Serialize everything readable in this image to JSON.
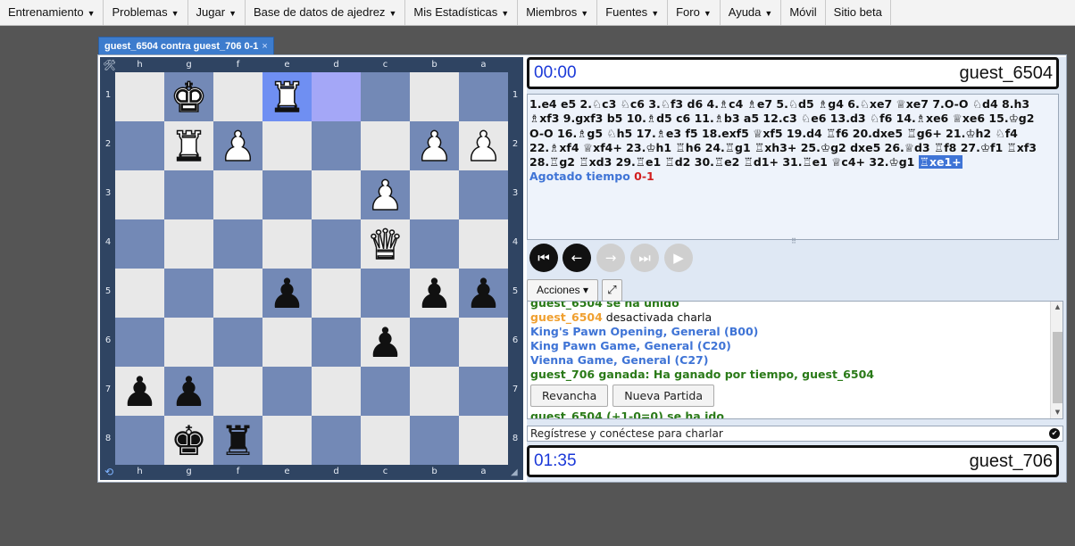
{
  "menu": [
    {
      "label": "Entrenamiento",
      "caret": true
    },
    {
      "label": "Problemas",
      "caret": true
    },
    {
      "label": "Jugar",
      "caret": true
    },
    {
      "label": "Base de datos de ajedrez",
      "caret": true
    },
    {
      "label": "Mis Estadísticas",
      "caret": true
    },
    {
      "label": "Miembros",
      "caret": true
    },
    {
      "label": "Fuentes",
      "caret": true
    },
    {
      "label": "Foro",
      "caret": true
    },
    {
      "label": "Ayuda",
      "caret": true
    },
    {
      "label": "Móvil",
      "caret": false
    },
    {
      "label": "Sitio beta",
      "caret": false
    }
  ],
  "tab": {
    "title": "guest_6504 contra guest_706 0-1",
    "close": "×"
  },
  "board": {
    "files_top": [
      "h",
      "g",
      "f",
      "e",
      "d",
      "c",
      "b",
      "a"
    ],
    "files_bottom": [
      "h",
      "g",
      "f",
      "e",
      "d",
      "c",
      "b",
      "a"
    ],
    "ranks": [
      "1",
      "2",
      "3",
      "4",
      "5",
      "6",
      "7",
      "8"
    ],
    "rows": [
      [
        "",
        "wK",
        "",
        "wR",
        "",
        "",
        "",
        ""
      ],
      [
        "",
        "wR",
        "wP",
        "",
        "",
        "",
        "wP",
        "wP"
      ],
      [
        "",
        "",
        "",
        "",
        "",
        "wP",
        "",
        ""
      ],
      [
        "",
        "",
        "",
        "",
        "",
        "wQ",
        "",
        ""
      ],
      [
        "",
        "",
        "",
        "bP",
        "",
        "",
        "bP",
        "bP"
      ],
      [
        "",
        "",
        "",
        "",
        "",
        "bP",
        "",
        ""
      ],
      [
        "bP",
        "bP",
        "",
        "",
        "",
        "",
        "",
        ""
      ],
      [
        "",
        "bK",
        "bR",
        "",
        "",
        "",
        "",
        ""
      ]
    ],
    "highlight_to": "e1",
    "highlight_from": "d1",
    "colors": {
      "light": "#e8e8e8",
      "dark": "#7389b6",
      "from": "#a4a7f7",
      "to": "#6f8ff2"
    },
    "glyphs": {
      "K": "♚",
      "Q": "♛",
      "R": "♜",
      "B": "♝",
      "N": "♞",
      "P": "♟"
    }
  },
  "clocks": {
    "top": {
      "time": "00:00",
      "player": "guest_6504"
    },
    "bottom": {
      "time": "01:35",
      "player": "guest_706"
    }
  },
  "moves": [
    "1.e4",
    "e5",
    "2.♘c3",
    "♘c6",
    "3.♘f3",
    "d6",
    "4.♗c4",
    "♗e7",
    "5.♘d5",
    "♗g4",
    "6.♘xe7",
    "♕xe7",
    "7.O-O",
    "♘d4",
    "8.h3",
    "♗xf3",
    "9.gxf3",
    "b5",
    "10.♗d5",
    "c6",
    "11.♗b3",
    "a5",
    "12.c3",
    "♘e6",
    "13.d3",
    "♘f6",
    "14.♗xe6",
    "♕xe6",
    "15.♔g2",
    "O-O",
    "16.♗g5",
    "♘h5",
    "17.♗e3",
    "f5",
    "18.exf5",
    "♕xf5",
    "19.d4",
    "♖f6",
    "20.dxe5",
    "♖g6+",
    "21.♔h2",
    "♘f4",
    "22.♗xf4",
    "♕xf4+",
    "23.♔h1",
    "♖h6",
    "24.♖g1",
    "♖xh3+",
    "25.♔g2",
    "dxe5",
    "26.♕d3",
    "♖f8",
    "27.♔f1",
    "♖xf3",
    "28.♖g2",
    "♖xd3",
    "29.♖e1",
    "♖d2",
    "30.♖e2",
    "♖d1+",
    "31.♖e1",
    "♕c4+",
    "32.♔g1",
    "♖xe1+"
  ],
  "result": {
    "reason": "Agotado tiempo",
    "score": "0-1"
  },
  "nav": {
    "first": "⏮",
    "back": "←",
    "forward": "→",
    "last": "⏭",
    "play": "▶"
  },
  "actions": {
    "label": "Acciones",
    "caret": "▾",
    "expand_icon": "⤢"
  },
  "chat": {
    "partial_top": "guest_6504 se ha unido",
    "lines": [
      {
        "who": "guest_6504",
        "text": "desactivada charla"
      },
      {
        "text": "King's Pawn Opening, General (B00)"
      },
      {
        "text": "King Pawn Game, General (C20)"
      },
      {
        "text": "Vienna Game, General (C27)"
      },
      {
        "text": "guest_706 ganada: Ha ganado por tiempo, guest_6504"
      }
    ],
    "buttons": {
      "rematch": "Revancha",
      "new_game": "Nueva Partida"
    },
    "last_line": "guest_6504 (+1-0=0) se ha ido"
  },
  "chat_input": {
    "placeholder": "Regístrese y conéctese para charlar",
    "send_icon": "✔"
  },
  "icons": {
    "tools": "🛠",
    "flip": "⟲",
    "grip": "◢",
    "grip_h": "⠿"
  }
}
